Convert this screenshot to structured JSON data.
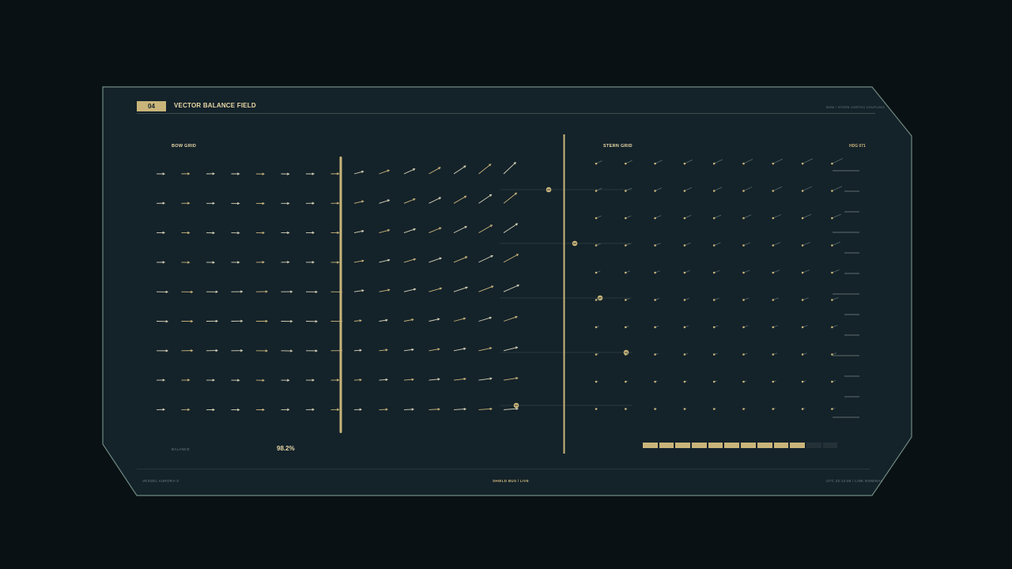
{
  "header": {
    "badge": "04",
    "title": "VECTOR BALANCE FIELD",
    "subtitle": "BOW / STERN VORTEX COUPLING"
  },
  "bow_grid": {
    "label": "BOW GRID"
  },
  "stern_grid": {
    "label": "STERN GRID",
    "heading": "HDG 071"
  },
  "balance": {
    "label": "BALANCE",
    "value": "98.2%"
  },
  "level_bar": {
    "segments": 12,
    "filled": 10
  },
  "footer": {
    "left": "VESSEL AURORA-3",
    "center": "SHIELD BUS / LIVE",
    "right": "UTC 22:14:06 / LINK NOMINAL"
  },
  "colors": {
    "background": "#0a1114",
    "panel": "#14222a",
    "frame": "#6f8a80",
    "accent": "#c9b57a",
    "text_light": "#e8d8a6",
    "text_dim": "#6f7f80"
  }
}
